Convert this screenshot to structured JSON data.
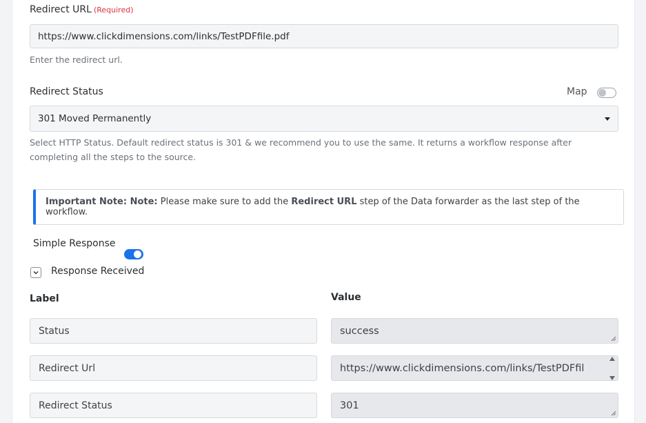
{
  "redirect_url": {
    "label": "Redirect URL",
    "required": "(Required)",
    "value": "https://www.clickdimensions.com/links/TestPDFfile.pdf",
    "help": "Enter the redirect url."
  },
  "redirect_status": {
    "label": "Redirect Status",
    "map_label": "Map",
    "map_enabled": false,
    "selected": "301 Moved Permanently",
    "help_line1": "Select HTTP Status. Default redirect status is 301 & we recommend you to use the same. It returns a workflow response after",
    "help_line2": "completing all the steps to the source."
  },
  "note": {
    "prefix": "Important Note: Note:",
    "text1": " Please make sure to add the ",
    "bold": "Redirect URL",
    "text2": " step of the Data forwarder as the last step of the workflow."
  },
  "simple_response": {
    "label": "Simple Response",
    "enabled": true
  },
  "response_received": {
    "label": "Response Received",
    "col_label": "Label",
    "col_value": "Value",
    "rows": [
      {
        "label": "Status",
        "value": "success"
      },
      {
        "label": "Redirect Url",
        "value": "https://www.clickdimensions.com/links/TestPDFfil"
      },
      {
        "label": "Redirect Status",
        "value": "301"
      }
    ]
  },
  "colors": {
    "accent": "#1a73e8",
    "required": "#d9363e"
  }
}
